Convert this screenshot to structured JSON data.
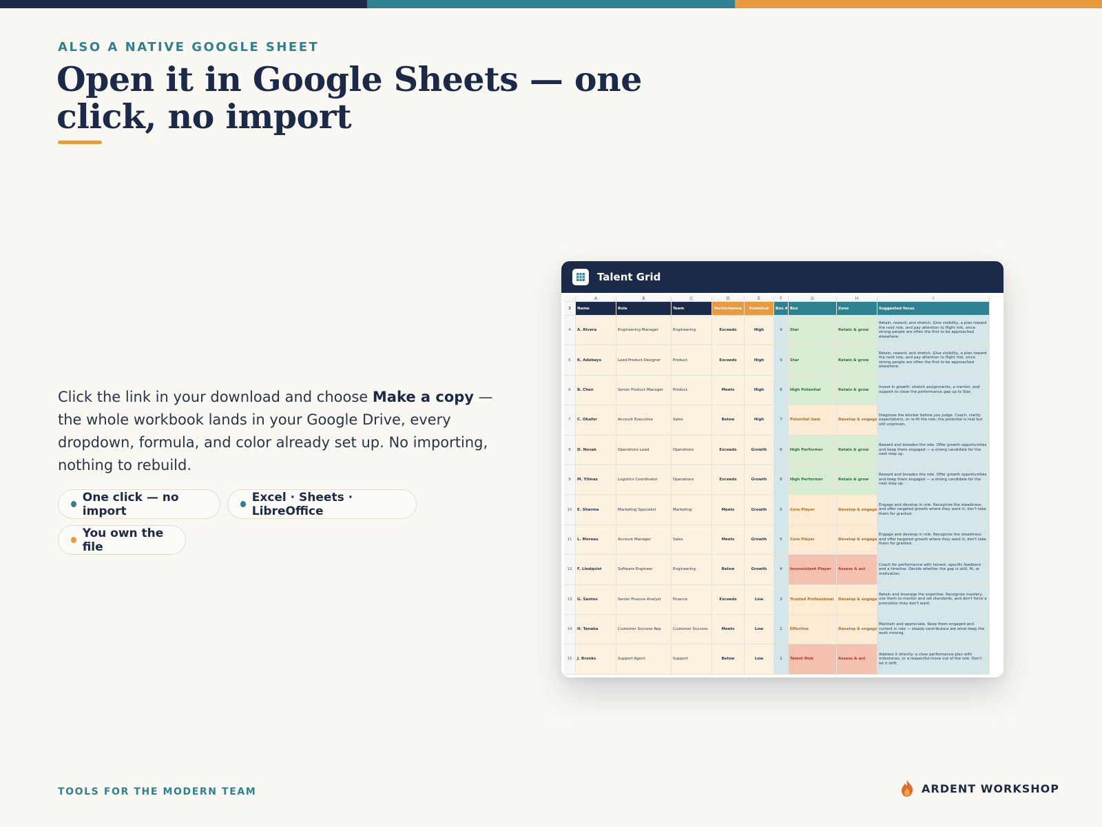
{
  "colors": {
    "navy": "#1b2a49",
    "teal": "#2e8290",
    "orange": "#ea9a3e",
    "background": "#faf8f2"
  },
  "eyebrow": "ALSO A NATIVE GOOGLE SHEET",
  "headline": "Open it in Google Sheets — one click, no import",
  "body": {
    "part1": "Click the link in your download and choose ",
    "bold": "Make a copy",
    "part2": " — the whole workbook lands in your Google Drive, every dropdown, formula, and color already set up. No importing, nothing to rebuild."
  },
  "chips": [
    {
      "label": "One click — no import",
      "dot_color": "#2e8290"
    },
    {
      "label": "Excel · Sheets · LibreOffice",
      "dot_color": "#2e8290"
    },
    {
      "label": "You own the file",
      "dot_color": "#ea9a3e"
    }
  ],
  "footer": {
    "tagline": "TOOLS FOR THE MODERN TEAM",
    "brand": "ARDENT WORKSHOP",
    "brand_icon": "flame-logo-icon"
  },
  "sheet": {
    "title": "Talent Grid",
    "icon": "spreadsheet-icon",
    "column_letters": [
      "A",
      "B",
      "C",
      "D",
      "E",
      "F",
      "G",
      "H",
      "I"
    ],
    "header_row_number": "3",
    "headers": [
      "Name",
      "Role",
      "Team",
      "Performance",
      "Potential",
      "Box #",
      "Box",
      "Zone",
      "Suggested focus"
    ],
    "rows": [
      {
        "n": "4",
        "name": "A. Rivera",
        "role": "Engineering Manager",
        "team": "Engineering",
        "perf": "Exceeds",
        "pot": "High",
        "box_num": "9",
        "box": "Star",
        "zone": "Retain & grow",
        "tone": "g",
        "focus": "Retain, reward, and stretch. Give visibility, a plan toward the next role, and pay attention to flight risk, since strong people are often the first to be approached elsewhere."
      },
      {
        "n": "5",
        "name": "K. Adebayo",
        "role": "Lead Product Designer",
        "team": "Product",
        "perf": "Exceeds",
        "pot": "High",
        "box_num": "9",
        "box": "Star",
        "zone": "Retain & grow",
        "tone": "g",
        "focus": "Retain, reward, and stretch. Give visibility, a plan toward the next role, and pay attention to flight risk, since strong people are often the first to be approached elsewhere."
      },
      {
        "n": "6",
        "name": "B. Chen",
        "role": "Senior Product Manager",
        "team": "Product",
        "perf": "Meets",
        "pot": "High",
        "box_num": "8",
        "box": "High Potential",
        "zone": "Retain & grow",
        "tone": "g",
        "focus": "Invest in growth: stretch assignments, a mentor, and support to close the performance gap up to Star."
      },
      {
        "n": "7",
        "name": "C. Okafor",
        "role": "Account Executive",
        "team": "Sales",
        "perf": "Below",
        "pot": "High",
        "box_num": "7",
        "box": "Potential Gem",
        "zone": "Develop & engage",
        "tone": "o",
        "focus": "Diagnose the blocker before you judge. Coach, clarify expectations, or re-fit the role; the potential is real but still unproven."
      },
      {
        "n": "8",
        "name": "D. Novak",
        "role": "Operations Lead",
        "team": "Operations",
        "perf": "Exceeds",
        "pot": "Growth",
        "box_num": "6",
        "box": "High Performer",
        "zone": "Retain & grow",
        "tone": "g",
        "focus": "Reward and broaden the role. Offer growth opportunities and keep them engaged — a strong candidate for the next step up."
      },
      {
        "n": "9",
        "name": "M. Yilmaz",
        "role": "Logistics Coordinator",
        "team": "Operations",
        "perf": "Exceeds",
        "pot": "Growth",
        "box_num": "6",
        "box": "High Performer",
        "zone": "Retain & grow",
        "tone": "g",
        "focus": "Reward and broaden the role. Offer growth opportunities and keep them engaged — a strong candidate for the next step up."
      },
      {
        "n": "10",
        "name": "E. Sharma",
        "role": "Marketing Specialist",
        "team": "Marketing",
        "perf": "Meets",
        "pot": "Growth",
        "box_num": "5",
        "box": "Core Player",
        "zone": "Develop & engage",
        "tone": "o",
        "focus": "Engage and develop in role. Recognize the steadiness and offer targeted growth where they want it; don't take them for granted."
      },
      {
        "n": "11",
        "name": "L. Moreau",
        "role": "Account Manager",
        "team": "Sales",
        "perf": "Meets",
        "pot": "Growth",
        "box_num": "5",
        "box": "Core Player",
        "zone": "Develop & engage",
        "tone": "o",
        "focus": "Engage and develop in role. Recognize the steadiness and offer targeted growth where they want it; don't take them for granted."
      },
      {
        "n": "12",
        "name": "F. Lindqvist",
        "role": "Software Engineer",
        "team": "Engineering",
        "perf": "Below",
        "pot": "Growth",
        "box_num": "4",
        "box": "Inconsistent Player",
        "zone": "Assess & act",
        "tone": "r",
        "focus": "Coach for performance with honest, specific feedback and a timeline. Decide whether the gap is skill, fit, or motivation."
      },
      {
        "n": "13",
        "name": "G. Santos",
        "role": "Senior Finance Analyst",
        "team": "Finance",
        "perf": "Exceeds",
        "pot": "Low",
        "box_num": "3",
        "box": "Trusted Professional",
        "zone": "Develop & engage",
        "tone": "o",
        "focus": "Retain and leverage the expertise. Recognize mastery, use them to mentor and set standards, and don't force a promotion they don't want."
      },
      {
        "n": "14",
        "name": "H. Tanaka",
        "role": "Customer Success Rep",
        "team": "Customer Success",
        "perf": "Meets",
        "pot": "Low",
        "box_num": "2",
        "box": "Effective",
        "zone": "Develop & engage",
        "tone": "o",
        "focus": "Maintain and appreciate. Keep them engaged and current in role — steady contributors are what keep the work moving."
      },
      {
        "n": "15",
        "name": "J. Brooks",
        "role": "Support Agent",
        "team": "Support",
        "perf": "Below",
        "pot": "Low",
        "box_num": "1",
        "box": "Talent Risk",
        "zone": "Assess & act",
        "tone": "r",
        "focus": "Address it directly: a clear performance plan with milestones, or a respectful move out of the role. Don't let it drift."
      }
    ]
  }
}
